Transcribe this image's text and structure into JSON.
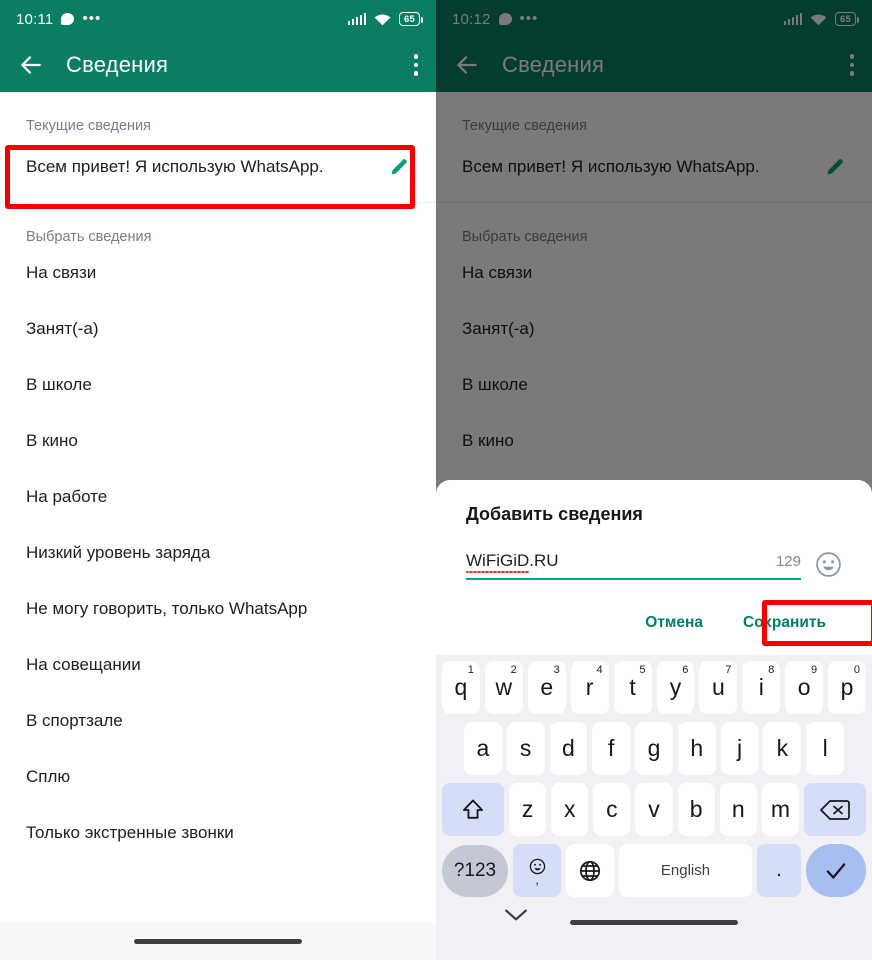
{
  "left": {
    "status": {
      "time": "10:11",
      "battery": "65",
      "icons": [
        "chat-bubble-icon",
        "more-dots-icon",
        "signal-icon",
        "wifi-icon",
        "battery-icon"
      ]
    },
    "appbar": {
      "title": "Сведения",
      "back_icon": "back-arrow-icon",
      "menu_icon": "overflow-menu-icon",
      "bg": "#0a7d63"
    },
    "current_label": "Текущие сведения",
    "current_value": "Всем привет! Я использую WhatsApp.",
    "edit_icon": "pencil-icon",
    "choose_label": "Выбрать сведения",
    "items": [
      "На связи",
      "Занят(-а)",
      "В школе",
      "В кино",
      "На работе",
      "Низкий уровень заряда",
      "Не могу говорить, только WhatsApp",
      "На совещании",
      "В спортзале",
      "Сплю",
      "Только экстренные звонки"
    ],
    "highlight_color": "#f40000"
  },
  "right": {
    "status": {
      "time": "10:12",
      "battery": "65"
    },
    "appbar": {
      "title": "Сведения"
    },
    "current_label": "Текущие сведения",
    "current_value": "Всем привет! Я использую WhatsApp.",
    "choose_label": "Выбрать сведения",
    "items": [
      "На связи",
      "Занят(-а)",
      "В школе",
      "В кино"
    ],
    "dialog": {
      "title": "Добавить сведения",
      "input_value": "WiFiGiD.RU",
      "char_count": "129",
      "emoji_icon": "emoji-smiley-icon",
      "cancel_label": "Отмена",
      "save_label": "Сохранить",
      "accent": "#047e63"
    },
    "keyboard": {
      "row1": [
        {
          "k": "q",
          "n": "1"
        },
        {
          "k": "w",
          "n": "2"
        },
        {
          "k": "e",
          "n": "3"
        },
        {
          "k": "r",
          "n": "4"
        },
        {
          "k": "t",
          "n": "5"
        },
        {
          "k": "y",
          "n": "6"
        },
        {
          "k": "u",
          "n": "7"
        },
        {
          "k": "i",
          "n": "8"
        },
        {
          "k": "o",
          "n": "9"
        },
        {
          "k": "p",
          "n": "0"
        }
      ],
      "row2": [
        "a",
        "s",
        "d",
        "f",
        "g",
        "h",
        "j",
        "k",
        "l"
      ],
      "row3": [
        "z",
        "x",
        "c",
        "v",
        "b",
        "n",
        "m"
      ],
      "shift_icon": "shift-up-icon",
      "backspace_icon": "backspace-icon",
      "num_label": "?123",
      "emoji_key_icon": "emoji-comma-icon",
      "globe_icon": "language-globe-icon",
      "space_label": "English",
      "period_label": ".",
      "enter_icon": "checkmark-icon",
      "collapse_icon": "chevron-down-icon"
    }
  }
}
